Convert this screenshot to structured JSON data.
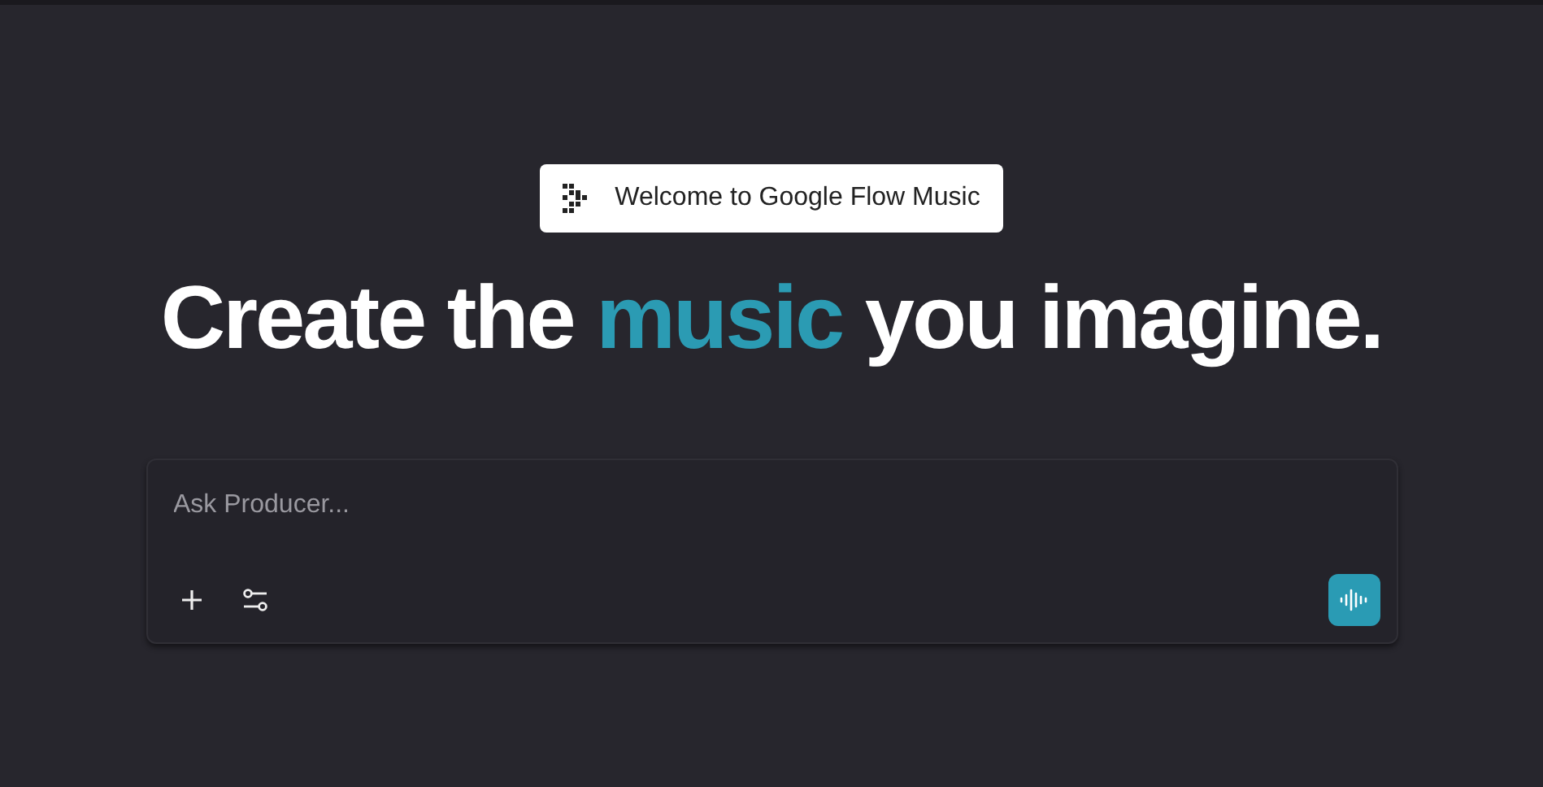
{
  "banner": {
    "label": "Welcome to Google Flow Music"
  },
  "headline": [
    {
      "text": "Create the ",
      "accent": false
    },
    {
      "text": "music",
      "accent": true
    },
    {
      "text": " you imagine.",
      "accent": false
    }
  ],
  "prompt": {
    "placeholder": "Ask Producer..."
  }
}
